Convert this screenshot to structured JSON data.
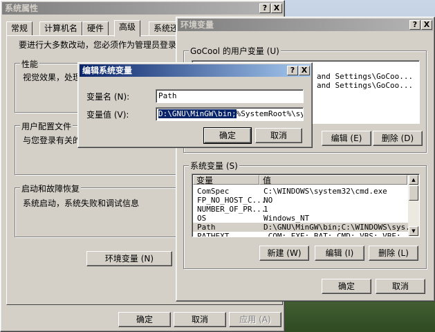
{
  "sysprops": {
    "title": "系统属性",
    "tabs": [
      "常规",
      "计算机名",
      "硬件",
      "高级",
      "系统还"
    ],
    "notice": "要进行大多数改动，您必须作为管理员登录。",
    "performance": {
      "label": "性能",
      "text": "视觉效果，处理"
    },
    "profiles": {
      "label": "用户配置文件",
      "text": "与您登录有关的"
    },
    "startup": {
      "label": "启动和故障恢复",
      "text": "系统启动，系统失败和调试信息"
    },
    "env_button": "环境变量 (N)",
    "ok": "确定",
    "cancel": "取消",
    "apply": "应用 (A)",
    "help_glyph": "?",
    "close_glyph": "X"
  },
  "envvars": {
    "title": "环境变量",
    "user_group": "GoCool 的用户变量 (U)",
    "user_rows": [
      "and Settings\\GoCoo...",
      "and Settings\\GoCoo..."
    ],
    "edit_button": "编辑 (E)",
    "delete_button": "删除 (D)",
    "sys_group": "系统变量 (S)",
    "sys_headers": {
      "name": "变量",
      "value": "值"
    },
    "sys_rows": [
      {
        "name": "ComSpec",
        "value": "C:\\WINDOWS\\system32\\cmd.exe"
      },
      {
        "name": "FP_NO_HOST_C...",
        "value": "NO"
      },
      {
        "name": "NUMBER_OF_PR...",
        "value": "1"
      },
      {
        "name": "OS",
        "value": "Windows_NT"
      },
      {
        "name": "Path",
        "value": "D:\\GNU\\MinGW\\bin;C:\\WINDOWS\\sys..."
      },
      {
        "name": "PATHEXT",
        "value": ".COM;.EXE;.BAT;.CMD;.VBS;.VBE;...."
      }
    ],
    "sys_new": "新建 (W)",
    "sys_edit": "编辑 (I)",
    "sys_delete": "删除 (L)",
    "ok": "确定",
    "cancel": "取消"
  },
  "editvar": {
    "title": "编辑系统变量",
    "name_label": "变量名 (N):",
    "name_value": "Path",
    "value_label": "变量值 (V):",
    "value_selected": "D:\\GNU\\MinGW\\bin;",
    "value_rest": "%SystemRoot%\\syster",
    "ok": "确定",
    "cancel": "取消"
  }
}
